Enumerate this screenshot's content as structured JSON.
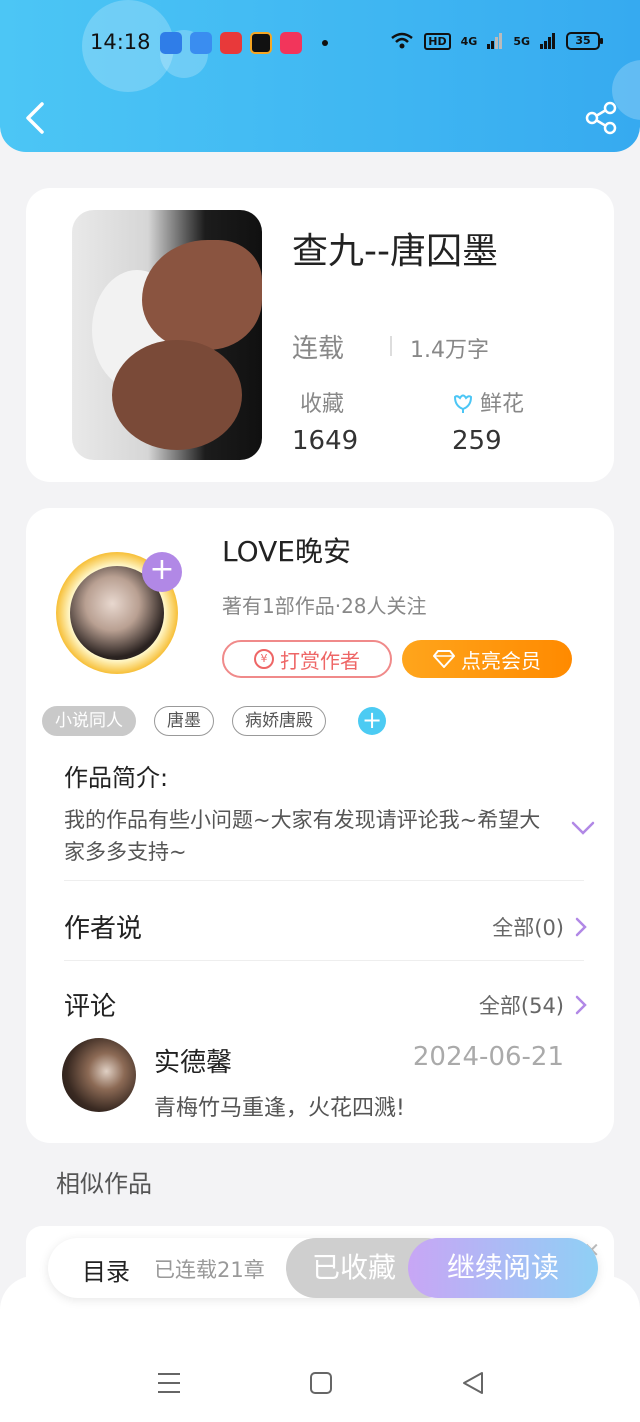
{
  "status_bar": {
    "time": "14:18",
    "network_label": "HD",
    "signal_4g": "4G",
    "signal_5g": "5G",
    "battery": "35"
  },
  "book": {
    "title": "查九--唐囚墨",
    "status": "连载",
    "word_count": "1.4万字",
    "favorites_label": "收藏",
    "favorites_value": "1649",
    "flowers_label": "鲜花",
    "flowers_value": "259"
  },
  "author": {
    "name": "LOVE晚安",
    "meta": "著有1部作品·28人关注",
    "reward_label": "打赏作者",
    "vip_label": "点亮会员"
  },
  "tags": [
    "小说同人",
    "唐墨",
    "病娇唐殿"
  ],
  "intro": {
    "title": "作品简介:",
    "text": "我的作品有些小问题~大家有发现请评论我~希望大家多多支持~"
  },
  "author_says": {
    "title": "作者说",
    "link": "全部(0)"
  },
  "comments": {
    "title": "评论",
    "link": "全部(54)",
    "items": [
      {
        "user": "实德馨",
        "date": "2024-06-21",
        "text": "青梅竹马重逢，火花四溅!"
      }
    ]
  },
  "similar": {
    "title": "相似作品"
  },
  "action_bar": {
    "toc_label": "目录",
    "chapters": "已连载21章",
    "collected_label": "已收藏",
    "continue_label": "继续阅读"
  },
  "colors": {
    "header": "#3fb6f2",
    "vip": "#ff8a00",
    "reward": "#e66666",
    "accent_purple": "#b188e6"
  }
}
